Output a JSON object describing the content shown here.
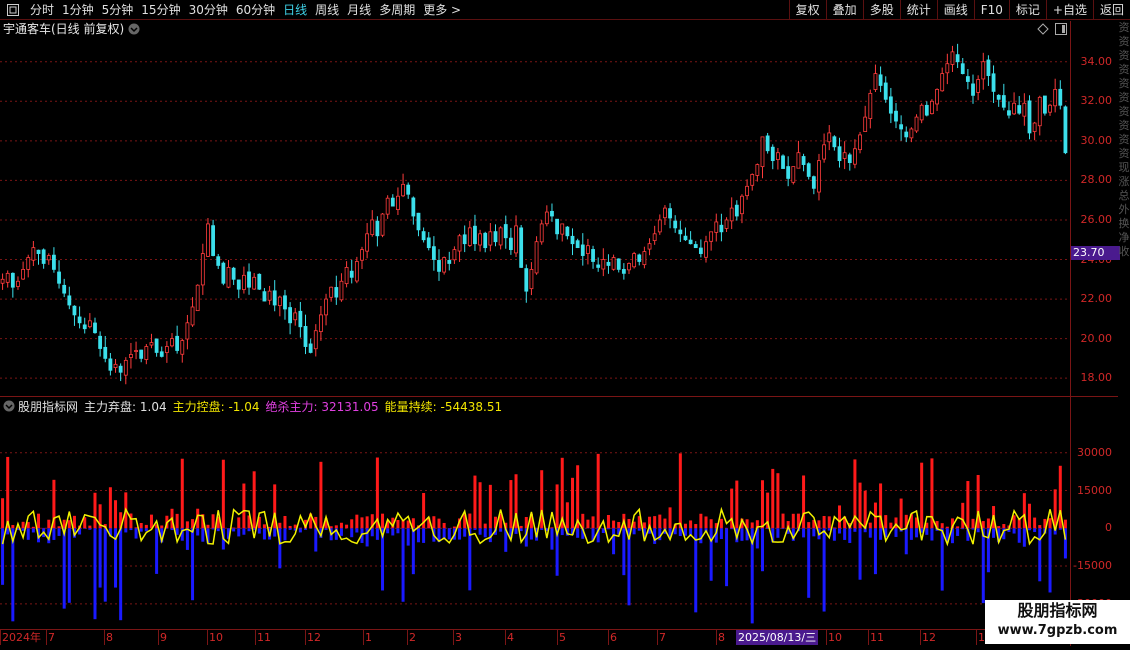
{
  "toolbar": {
    "periods": [
      "分时",
      "1分钟",
      "5分钟",
      "15分钟",
      "30分钟",
      "60分钟",
      "日线",
      "周线",
      "月线",
      "多周期",
      "更多 >"
    ],
    "active_period": "日线",
    "actions": [
      "复权",
      "叠加",
      "多股",
      "统计",
      "画线",
      "F10",
      "标记",
      "+自选",
      "返回"
    ]
  },
  "main_chart": {
    "title": "宇通客车(日线 前复权)",
    "price_ticks": [
      "34.00",
      "32.00",
      "30.00",
      "28.00",
      "26.00",
      "24.00",
      "22.00",
      "20.00",
      "18.00"
    ],
    "current_price_tag": "23.70"
  },
  "indicator": {
    "name": "股朋指标网",
    "items": [
      {
        "label": "主力弃盘: 1.04",
        "color": "#e0e0e0"
      },
      {
        "label": "主力控盘: -1.04",
        "color": "#f2e600"
      },
      {
        "label": "绝杀主力: 32131.05",
        "color": "#e040e0"
      },
      {
        "label": "能量持续: -54438.51",
        "color": "#f2e600"
      }
    ],
    "ticks": [
      "30000",
      "15000",
      "0",
      "-15000",
      "-30000"
    ]
  },
  "date_axis": {
    "labels": [
      "2024年",
      "7",
      "8",
      "9",
      "10",
      "11",
      "12",
      "1",
      "2",
      "3",
      "4",
      "5",
      "6",
      "7",
      "8",
      "9",
      "10",
      "11",
      "12",
      "1"
    ],
    "cursor_label": "2025/08/13/三"
  },
  "right_strip_chars": [
    "资",
    "资",
    "资",
    "资",
    "资",
    "资",
    "资",
    "资",
    "资",
    "资",
    "现",
    "涨",
    "总",
    "外",
    "换",
    "净",
    "收"
  ],
  "watermark": {
    "line1": "股朋指标网",
    "line2": "www.7gpzb.com"
  },
  "colors": {
    "up": "#ff3c3c",
    "down": "#3ce0ec",
    "red_bar": "#ff1a1a",
    "blue_bar": "#1a1aff",
    "yellow_line": "#f2f200",
    "grid": "#7a1515"
  },
  "chart_data": {
    "type": "line",
    "title": "宇通客车(日线 前复权)",
    "ylim": [
      17.2,
      35.2
    ],
    "series": [
      {
        "values": [
          23.0,
          23.3,
          22.6,
          22.9,
          23.5,
          24.1,
          24.6,
          24.3,
          23.8,
          24.2,
          23.5,
          22.8,
          22.3,
          21.7,
          21.2,
          20.8,
          20.5,
          20.9,
          20.3,
          19.5,
          19.0,
          18.4,
          18.7,
          18.3,
          18.9,
          19.2,
          19.4,
          19.0,
          19.6,
          19.8,
          19.3,
          19.1,
          19.6,
          20.0,
          19.4,
          19.9,
          20.8,
          21.6,
          22.7,
          24.3,
          25.8,
          24.2,
          23.7,
          22.8,
          23.6,
          23.0,
          22.5,
          23.2,
          22.6,
          23.1,
          22.5,
          21.9,
          22.4,
          21.7,
          22.1,
          21.5,
          20.8,
          21.3,
          20.6,
          19.6,
          19.3,
          20.4,
          21.2,
          22.0,
          22.6,
          22.1,
          22.9,
          23.6,
          23.1,
          23.9,
          24.5,
          25.3,
          26.0,
          25.2,
          26.3,
          27.1,
          26.7,
          27.2,
          27.8,
          27.3,
          26.2,
          25.5,
          25.0,
          24.6,
          24.0,
          23.4,
          24.1,
          23.8,
          24.5,
          25.2,
          24.8,
          25.6,
          24.8,
          25.3,
          24.6,
          25.4,
          24.9,
          25.6,
          25.1,
          24.5,
          25.7,
          23.6,
          22.4,
          23.5,
          24.9,
          25.8,
          26.4,
          26.2,
          25.3,
          25.8,
          25.2,
          24.8,
          24.6,
          24.2,
          24.7,
          23.9,
          23.6,
          24.0,
          23.7,
          24.1,
          23.5,
          23.3,
          23.8,
          24.3,
          23.9,
          24.4,
          24.8,
          25.3,
          26.0,
          26.6,
          26.1,
          25.6,
          25.3,
          25.0,
          24.8,
          24.6,
          24.3,
          24.9,
          25.4,
          25.9,
          25.4,
          26.0,
          26.6,
          26.2,
          27.2,
          27.7,
          28.3,
          28.8,
          30.2,
          29.5,
          29.0,
          29.4,
          28.6,
          28.1,
          28.7,
          29.4,
          28.8,
          28.2,
          27.6,
          29.0,
          29.8,
          30.4,
          29.7,
          29.0,
          29.4,
          28.9,
          29.6,
          30.3,
          31.2,
          32.4,
          33.4,
          32.8,
          32.1,
          31.4,
          31.0,
          30.6,
          30.2,
          30.6,
          31.2,
          31.8,
          31.3,
          32.0,
          32.6,
          33.4,
          33.9,
          34.5,
          34.0,
          33.4,
          33.0,
          32.3,
          33.1,
          34.0,
          33.3,
          32.5,
          32.1,
          31.7,
          31.3,
          31.9,
          31.4,
          31.9,
          30.4,
          30.9,
          32.2,
          31.4,
          31.8,
          32.6,
          31.8,
          29.4
        ]
      }
    ]
  }
}
